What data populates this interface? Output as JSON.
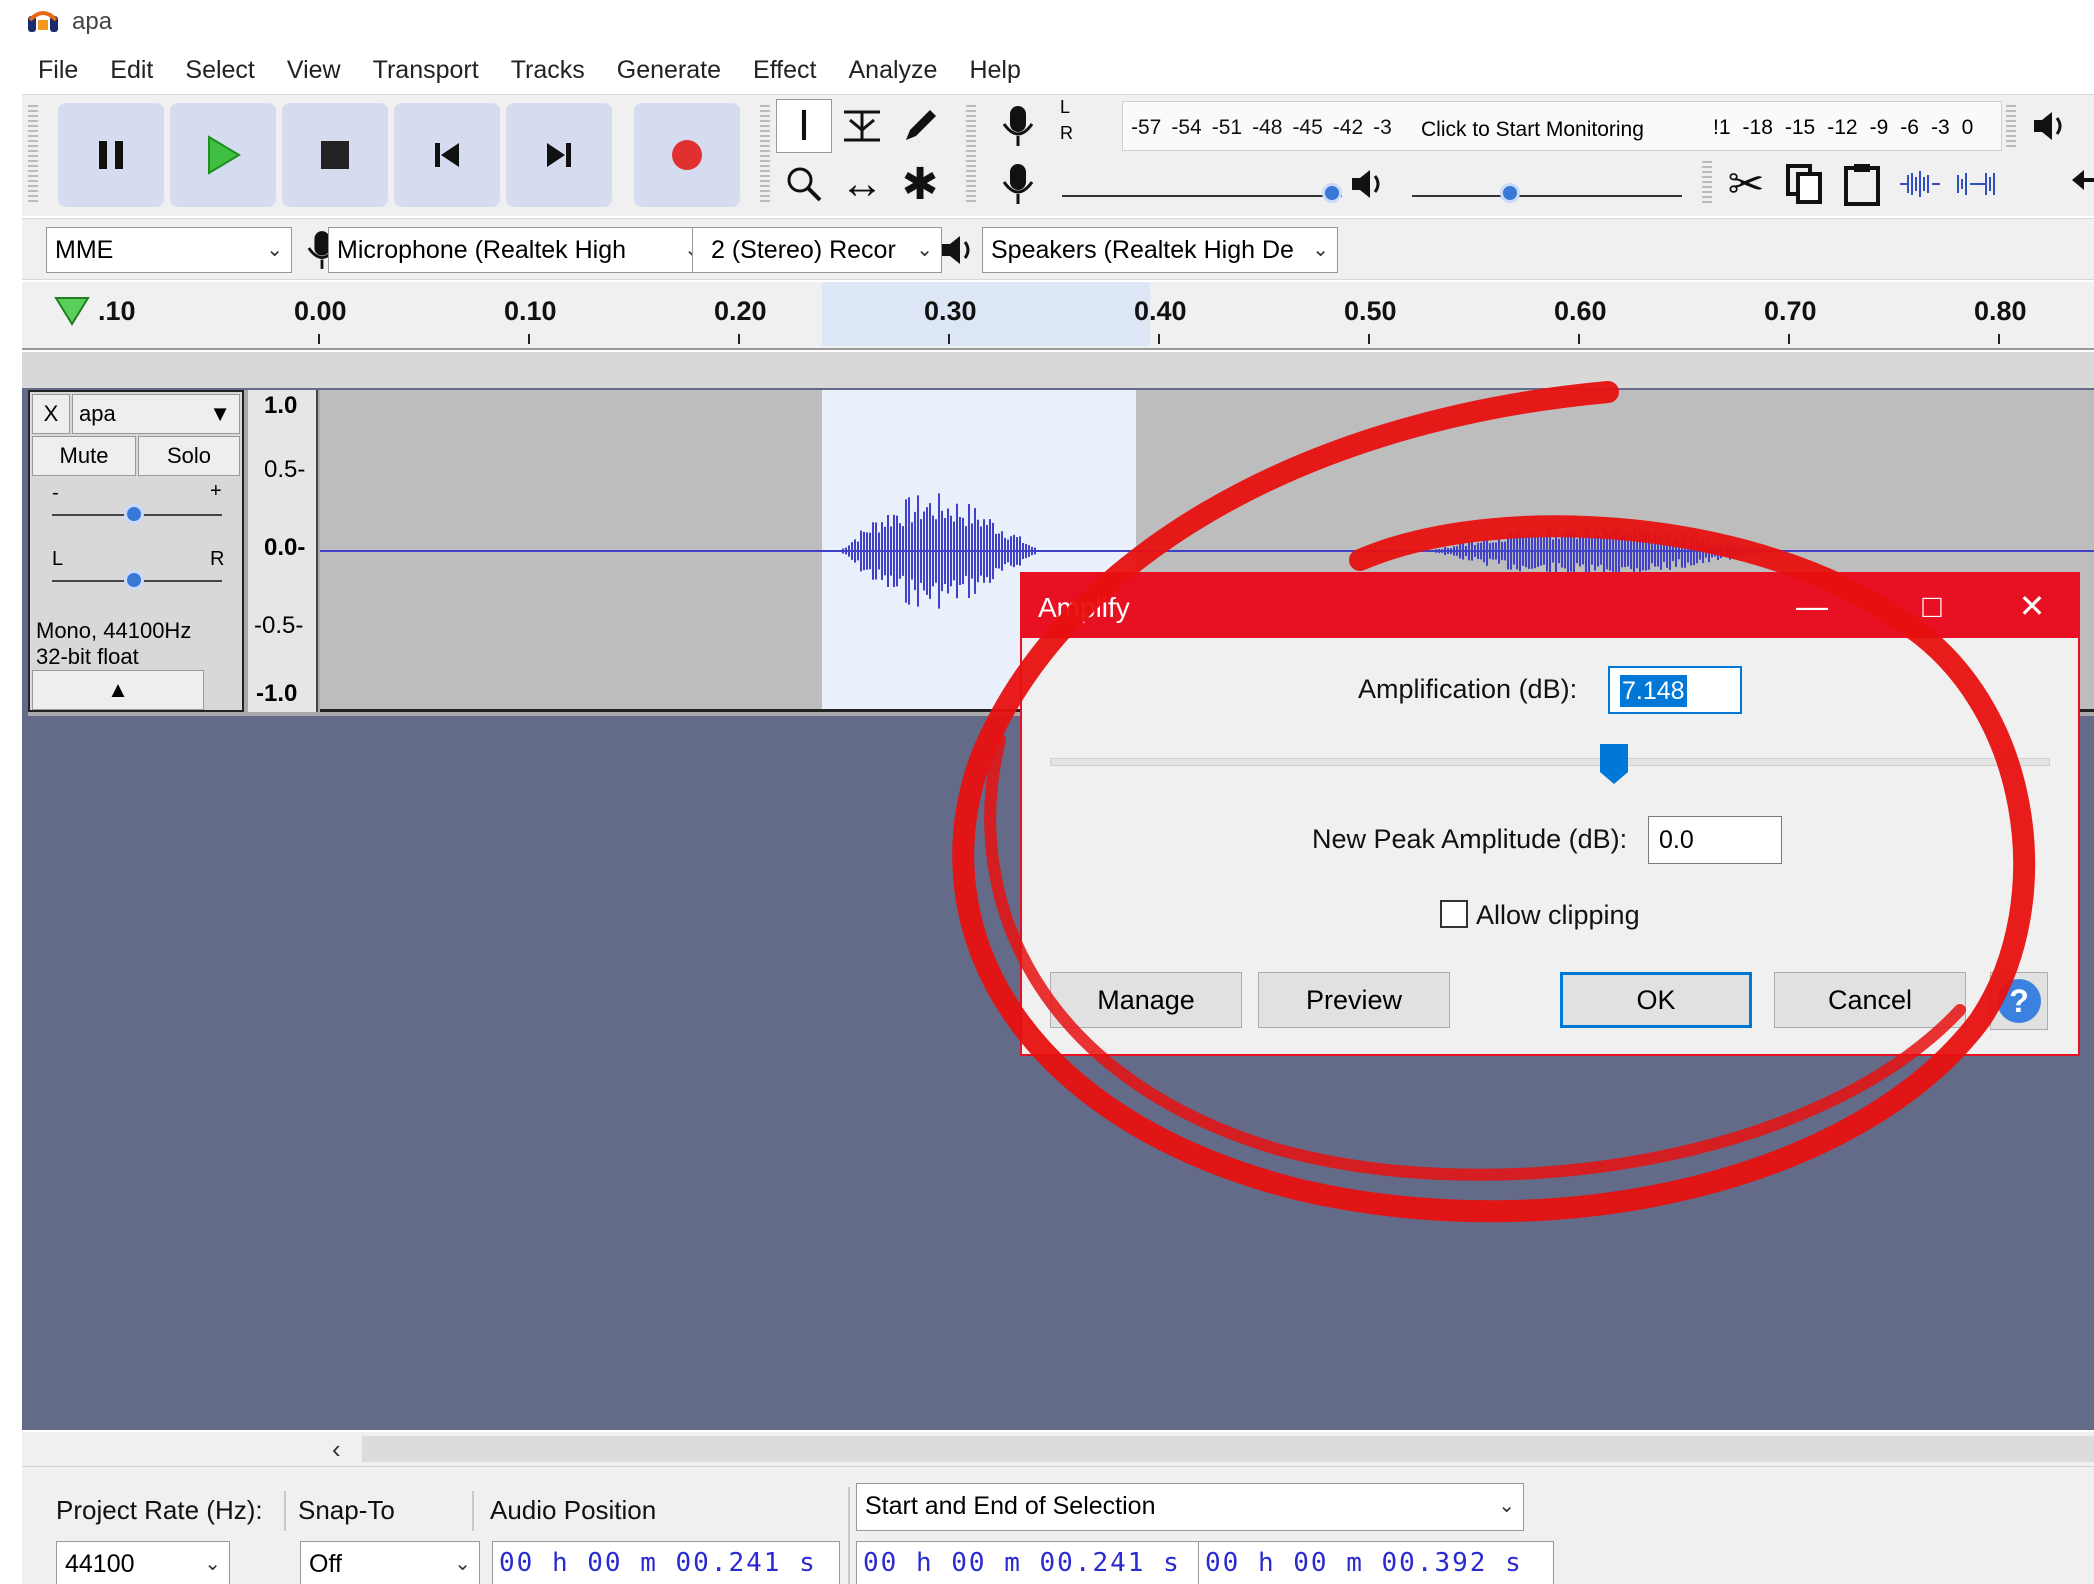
{
  "window": {
    "title": "apa"
  },
  "menu": [
    "File",
    "Edit",
    "Select",
    "View",
    "Transport",
    "Tracks",
    "Generate",
    "Effect",
    "Analyze",
    "Help"
  ],
  "meter": {
    "lr_l": "L",
    "lr_r": "R",
    "scale": [
      "-57",
      "-54",
      "-51",
      "-48",
      "-45",
      "-42",
      "-3"
    ],
    "scale_right": [
      "!1",
      "-18",
      "-15",
      "-12",
      "-9",
      "-6",
      "-3",
      "0"
    ],
    "click_text": "Click to Start Monitoring"
  },
  "device": {
    "host": "MME",
    "mic": "Microphone (Realtek High",
    "channels": "2 (Stereo) Recor",
    "speakers": "Speakers (Realtek High De"
  },
  "ruler": {
    "labels": [
      ".10",
      "0.00",
      "0.10",
      "0.20",
      "0.30",
      "0.40",
      "0.50",
      "0.60",
      "0.70",
      "0.80"
    ]
  },
  "track": {
    "name": "apa",
    "close": "X",
    "mute": "Mute",
    "solo": "Solo",
    "gain_minus": "-",
    "gain_plus": "+",
    "pan_l": "L",
    "pan_r": "R",
    "info_line1": "Mono, 44100Hz",
    "info_line2": "32-bit float",
    "vruler": [
      "1.0",
      "0.5-",
      "0.0-",
      "-0.5-",
      "-1.0"
    ]
  },
  "status": {
    "project_rate_label": "Project Rate (Hz):",
    "project_rate_value": "44100",
    "snap_label": "Snap-To",
    "snap_value": "Off",
    "audio_position_label": "Audio Position",
    "audio_position_value": "00 h 00 m 00.241 s",
    "selection_label": "Start and End of Selection",
    "selection_start": "00 h 00 m 00.241 s",
    "selection_end": "00 h 00 m 00.392 s"
  },
  "dialog": {
    "title": "Amplify",
    "amplification_label": "Amplification (dB):",
    "amplification_value": "7.148",
    "peak_label": "New Peak Amplitude (dB):",
    "peak_value": "0.0",
    "allow_clipping_label": "Allow clipping",
    "allow_clipping_checked": false,
    "manage": "Manage",
    "preview": "Preview",
    "ok": "OK",
    "cancel": "Cancel",
    "help": "?"
  },
  "colors": {
    "dialog_accent": "#e81123",
    "waveform": "#4040c8",
    "annotation": "#e81010"
  }
}
